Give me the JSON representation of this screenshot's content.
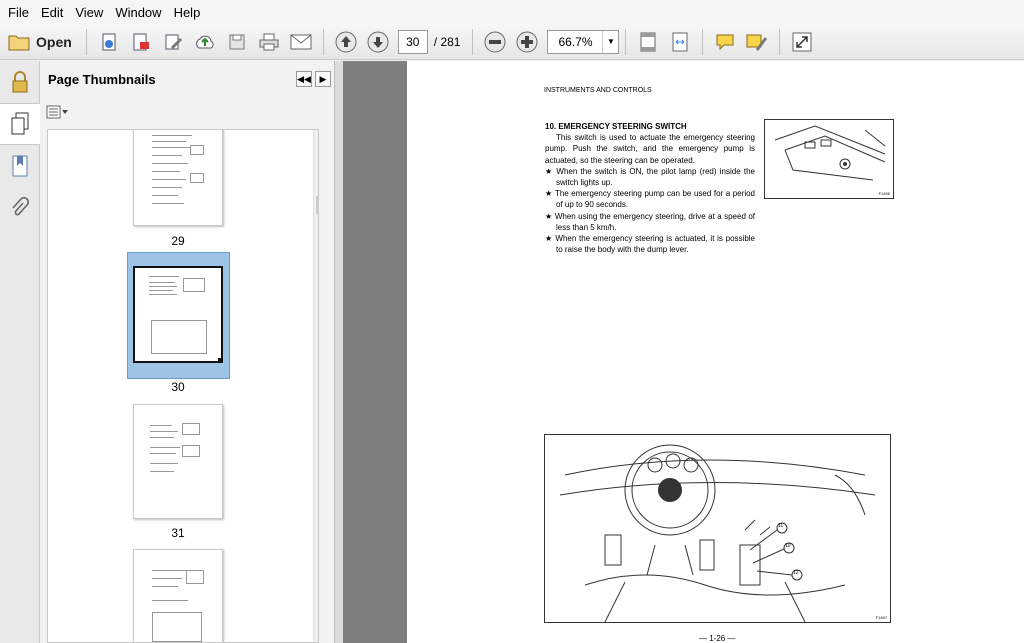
{
  "menu": [
    "File",
    "Edit",
    "View",
    "Window",
    "Help"
  ],
  "toolbar": {
    "open_label": "Open",
    "page_current": "30",
    "page_total": "/ 281",
    "zoom": "66.7%"
  },
  "panel": {
    "title": "Page Thumbnails",
    "thumbnails": [
      {
        "label": "29"
      },
      {
        "label": "30"
      },
      {
        "label": "31"
      }
    ]
  },
  "document": {
    "header": "INSTRUMENTS AND CONTROLS",
    "section_title": "10.  EMERGENCY STEERING SWITCH",
    "body": "This switch is used to actuate the emergency steering pump. Push the switch, and the emergency pump is actuated, so the steering can be operated.",
    "bullets": [
      "When the switch is ON, the pilot lamp (red) inside the switch lights up.",
      "The emergency steering pump can be used for a period of up to 90 seconds.",
      "When using the emergency steering, drive at a speed of less than 5 km/h.",
      "When the emergency steering is actuated, it is possible to raise the body with the dump lever."
    ],
    "bullet_mark": "★",
    "fig1_code": "F1496",
    "fig2_code": "F1497",
    "callouts": [
      "11",
      "10",
      "12"
    ],
    "page_number": "— 1-26 —"
  },
  "colors": {
    "doc_background": "#7f7f7f",
    "selected_thumb": "#9dc3e6"
  }
}
